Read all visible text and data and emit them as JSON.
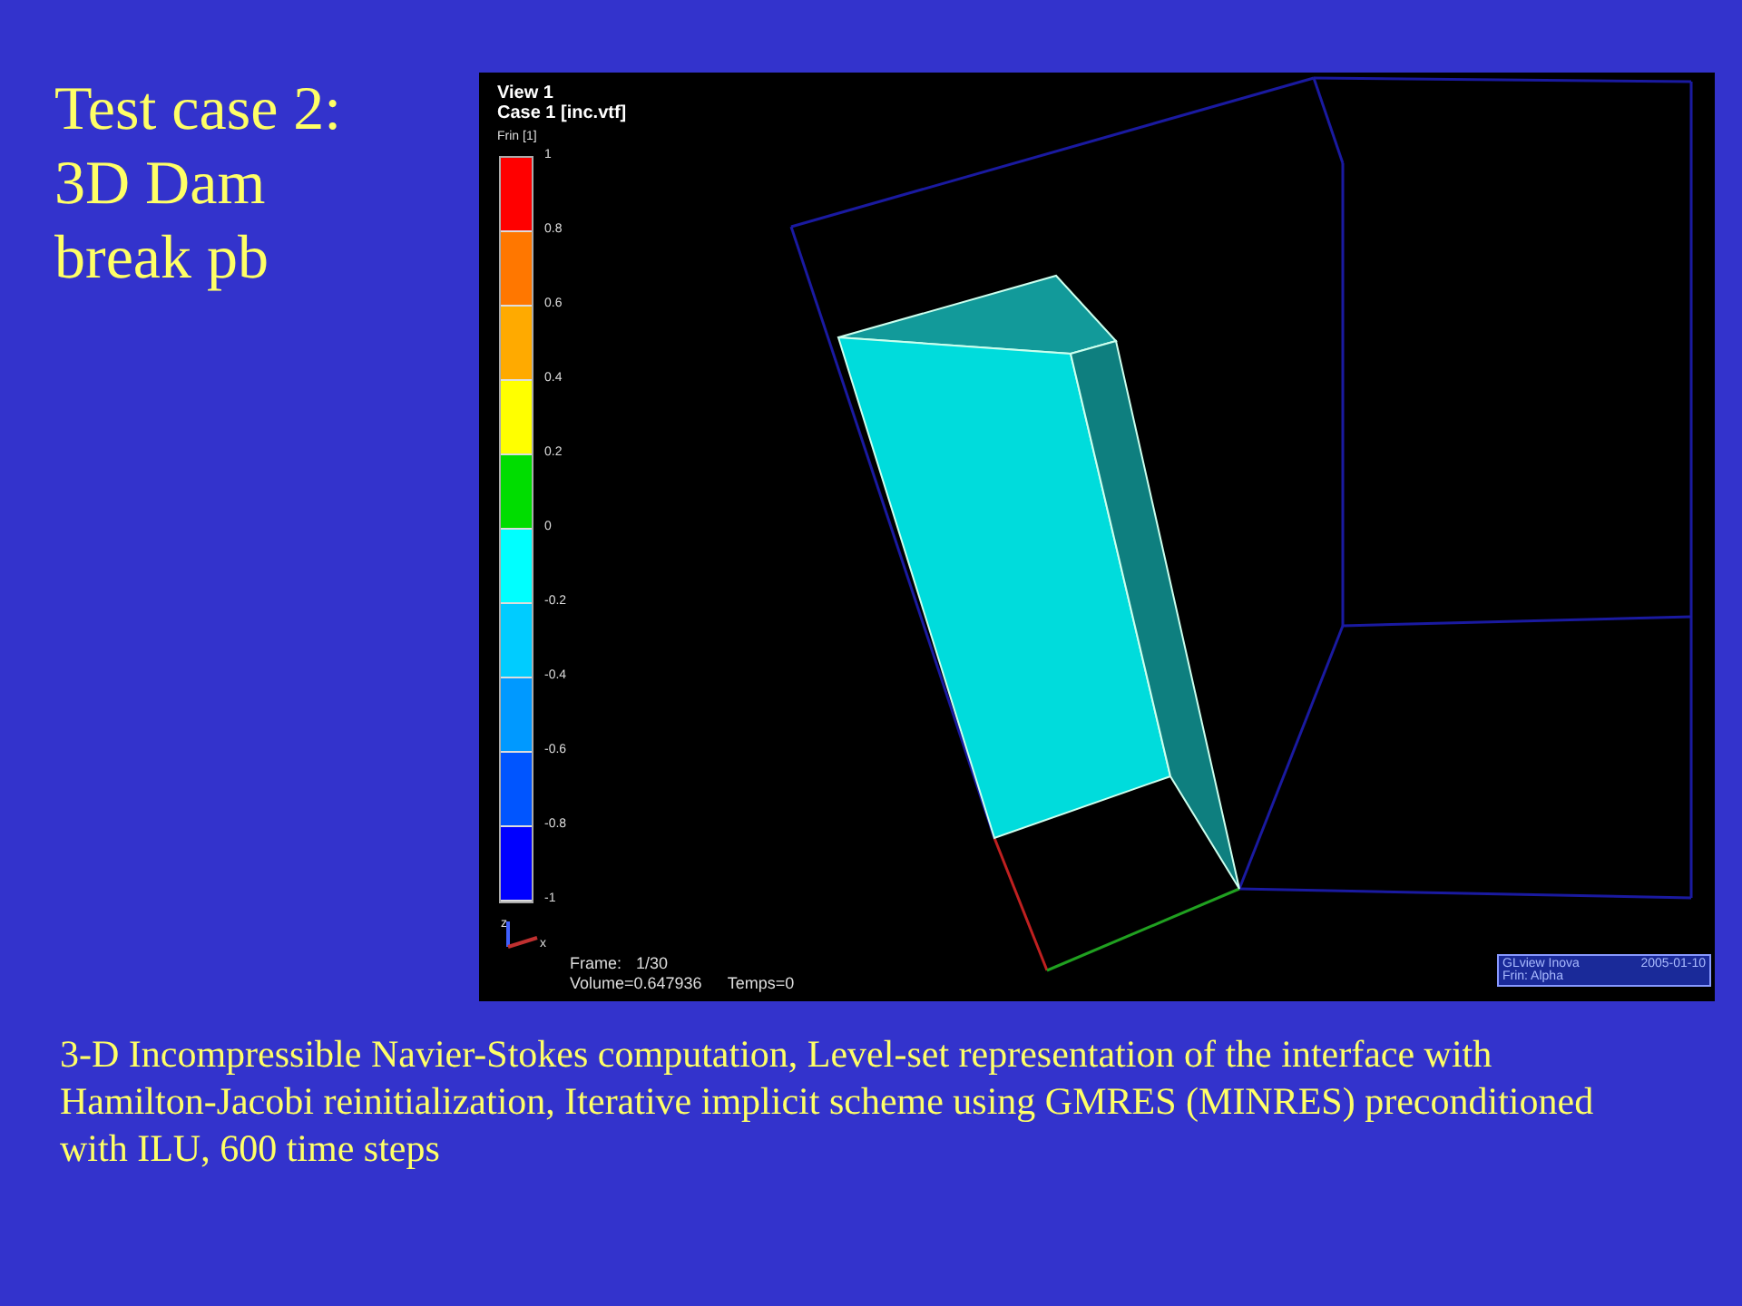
{
  "title_lines": [
    "Test case 2:",
    "3D Dam",
    "break pb"
  ],
  "viewer": {
    "view_label": "View 1",
    "case_label": "Case 1  [inc.vtf]",
    "colorbar": {
      "title": "Frin [1]",
      "ticks": [
        "1",
        "0.8",
        "0.6",
        "0.4",
        "0.2",
        "0",
        "-0.2",
        "-0.4",
        "-0.6",
        "-0.8",
        "-1"
      ],
      "segments": [
        {
          "color": "#ff0000"
        },
        {
          "color": "#ff7700"
        },
        {
          "color": "#ffaa00"
        },
        {
          "color": "#ffff00"
        },
        {
          "color": "#00dd00"
        },
        {
          "color": "#00ffff"
        },
        {
          "color": "#00ccff"
        },
        {
          "color": "#0099ff"
        },
        {
          "color": "#0055ff"
        },
        {
          "color": "#0000ff"
        }
      ]
    },
    "frame_label": "Frame:",
    "frame_value": "1/30",
    "volume": "Volume=0.647936",
    "temps": "Temps=0",
    "axis_labels": [
      "z",
      "x"
    ],
    "logo": {
      "name": "GLview Inova",
      "date": "2005-01-10",
      "field": "Frin:  Alpha"
    }
  },
  "caption": "3-D Incompressible Navier-Stokes computation, Level-set representation of the interface with Hamilton-Jacobi reinitialization, Iterative implicit scheme using GMRES (MINRES) preconditioned with ILU, 600 time steps"
}
